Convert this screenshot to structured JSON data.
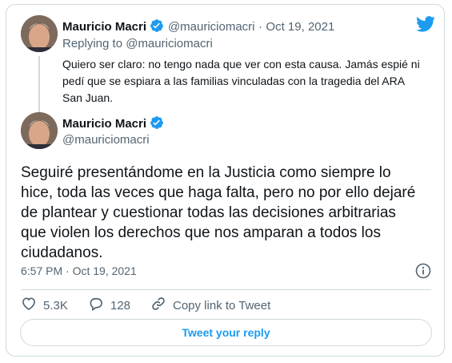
{
  "quoted_tweet": {
    "name": "Mauricio Macri",
    "handle": "@mauriciomacri",
    "separator": "·",
    "date": "Oct 19, 2021",
    "replying_to": "Replying to @mauriciomacri",
    "text": "Quiero ser claro: no tengo nada que ver con esta causa. Jamás espié ni pedí que se espiara a las familias vinculadas con la tragedia del ARA San Juan."
  },
  "main_tweet": {
    "name": "Mauricio Macri",
    "handle": "@mauriciomacri",
    "text": "Seguiré presentándome en la Justicia como siempre lo hice, toda las veces que haga falta, pero no por ello dejaré de plantear y cuestionar todas las decisiones arbitrarias que violen los derechos que nos amparan a todos los ciudadanos.",
    "timestamp": "6:57 PM · Oct 19, 2021"
  },
  "actions": {
    "likes": "5.3K",
    "replies": "128",
    "copy_link": "Copy link to Tweet"
  },
  "reply_button": "Tweet your reply",
  "colors": {
    "brand": "#1d9bf0",
    "text": "#0f1419",
    "muted": "#536471",
    "border": "#cfd9de"
  },
  "icons": [
    "twitter-bird-icon",
    "verified-badge-icon",
    "info-icon",
    "heart-icon",
    "reply-bubble-icon",
    "link-icon"
  ]
}
